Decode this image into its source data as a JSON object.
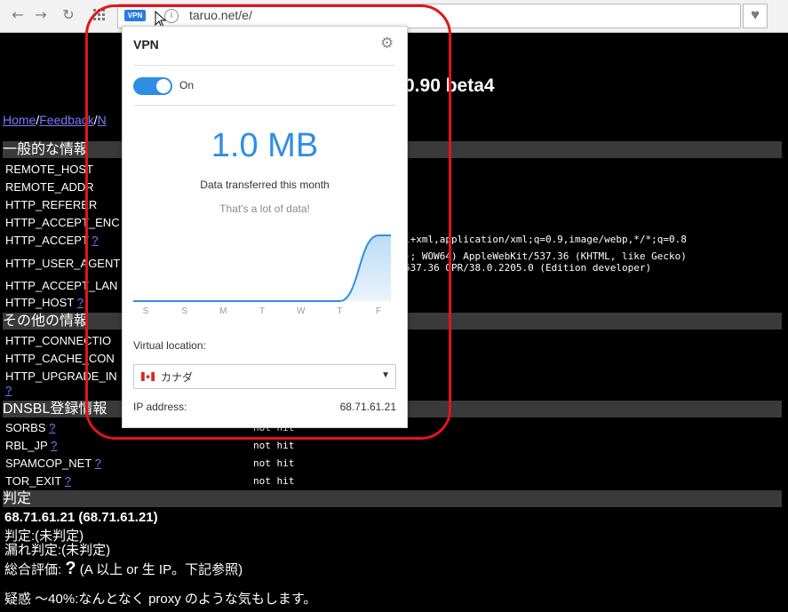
{
  "browser": {
    "url": "taruo.net/e/",
    "vpn_badge": "VPN",
    "icons": [
      "back-arrow-icon",
      "forward-arrow-icon",
      "reload-icon",
      "speed-dial-grid-icon",
      "info-icon",
      "heart-icon",
      "cursor-icon"
    ]
  },
  "page": {
    "title": "0.90 beta4",
    "breadcrumb": [
      "Home",
      "Feedback",
      "N"
    ],
    "sections": [
      "一般的な情報",
      "その他の情報",
      "DNSBL登録情報",
      "判定"
    ],
    "rows": {
      "remote_host": "REMOTE_HOST",
      "remote_addr": "REMOTE_ADDR",
      "http_referer": "HTTP_REFERER",
      "http_accept_enc": "HTTP_ACCEPT_ENC",
      "http_accept": "HTTP_ACCEPT",
      "http_user_agent": "HTTP_USER_AGENT",
      "http_accept_lan": "HTTP_ACCEPT_LAN",
      "http_host": "HTTP_HOST",
      "http_connectio": "HTTP_CONNECTIO",
      "http_cache_con": "HTTP_CACHE_CON",
      "http_upgrade_in": "HTTP_UPGRADE_IN",
      "sorbs": "SORBS",
      "rbl_jp": "RBL_JP",
      "spamcop_net": "SPAMCOP_NET",
      "tor_exit": "TOR_EXIT"
    },
    "help_mark": "?",
    "values": {
      "accept": "l+xml,application/xml;q=0.9,image/webp,*/*;q=0.8",
      "ua_line1": "); WOW64) AppleWebKit/537.36 (KHTML, like Gecko)",
      "ua_line2": "537.36 OPR/38.0.2205.0 (Edition developer)",
      "not_hit": "not hit"
    },
    "verdict": {
      "ip": "68.71.61.21 (68.71.61.21)",
      "judgement": "判定:(未判定)",
      "leak": "漏れ判定:(未判定)",
      "overall_prefix": "総合評価:",
      "overall_mark": "?",
      "overall_suffix": "(A 以上 or 生 IP。下記参照)",
      "suspicion": "疑惑 〜40%:なんとなく proxy のような気もします。"
    }
  },
  "vpn_popup": {
    "title": "VPN",
    "toggle_label": "On",
    "toggle_on": true,
    "data_amount": "1.0 MB",
    "data_caption": "Data transferred this month",
    "data_comment": "That's a lot of data!",
    "virtual_location_label": "Virtual location:",
    "location": "カナダ",
    "ip_label": "IP address:",
    "ip_value": "68.71.61.21",
    "accent_color": "#2f8ee3"
  },
  "chart_data": {
    "type": "area",
    "categories": [
      "S",
      "S",
      "M",
      "T",
      "W",
      "T",
      "F"
    ],
    "values": [
      0,
      0,
      0,
      0,
      0,
      0,
      1.0
    ],
    "ylim": [
      0,
      1.0
    ],
    "grid": false,
    "legend": "none"
  }
}
